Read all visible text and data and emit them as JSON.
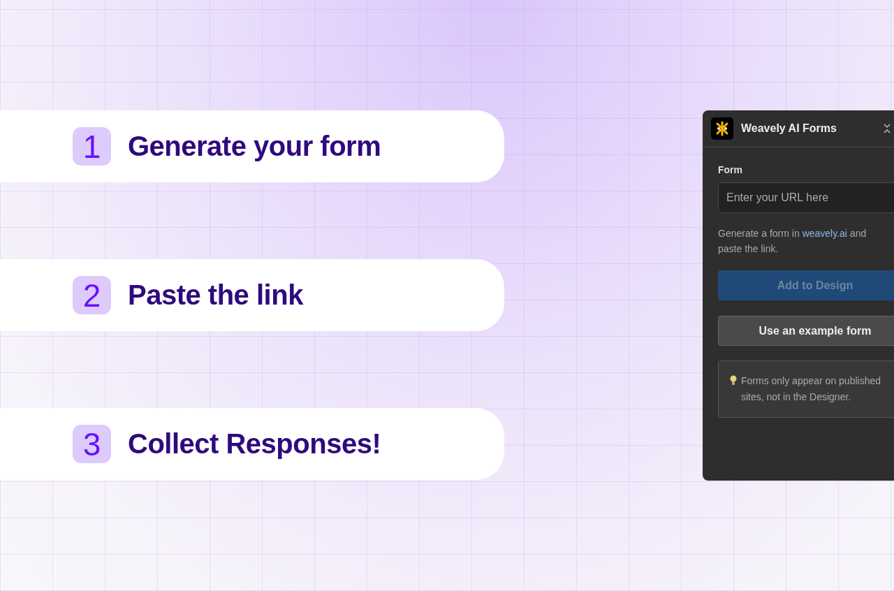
{
  "steps": [
    {
      "number": "1",
      "label": "Generate your form"
    },
    {
      "number": "2",
      "label": "Paste the link"
    },
    {
      "number": "3",
      "label": "Collect Responses!"
    }
  ],
  "panel": {
    "title": "Weavely AI Forms",
    "form_label": "Form",
    "url_placeholder": "Enter your URL here",
    "help_before": "Generate a form in ",
    "help_link": "weavely.ai",
    "help_after": " and paste the link.",
    "add_button": {
      "label": "Add to Design",
      "disabled": true
    },
    "example_button": {
      "label": "Use an example form"
    },
    "note": "Forms only appear on published sites, not in the Designer."
  }
}
